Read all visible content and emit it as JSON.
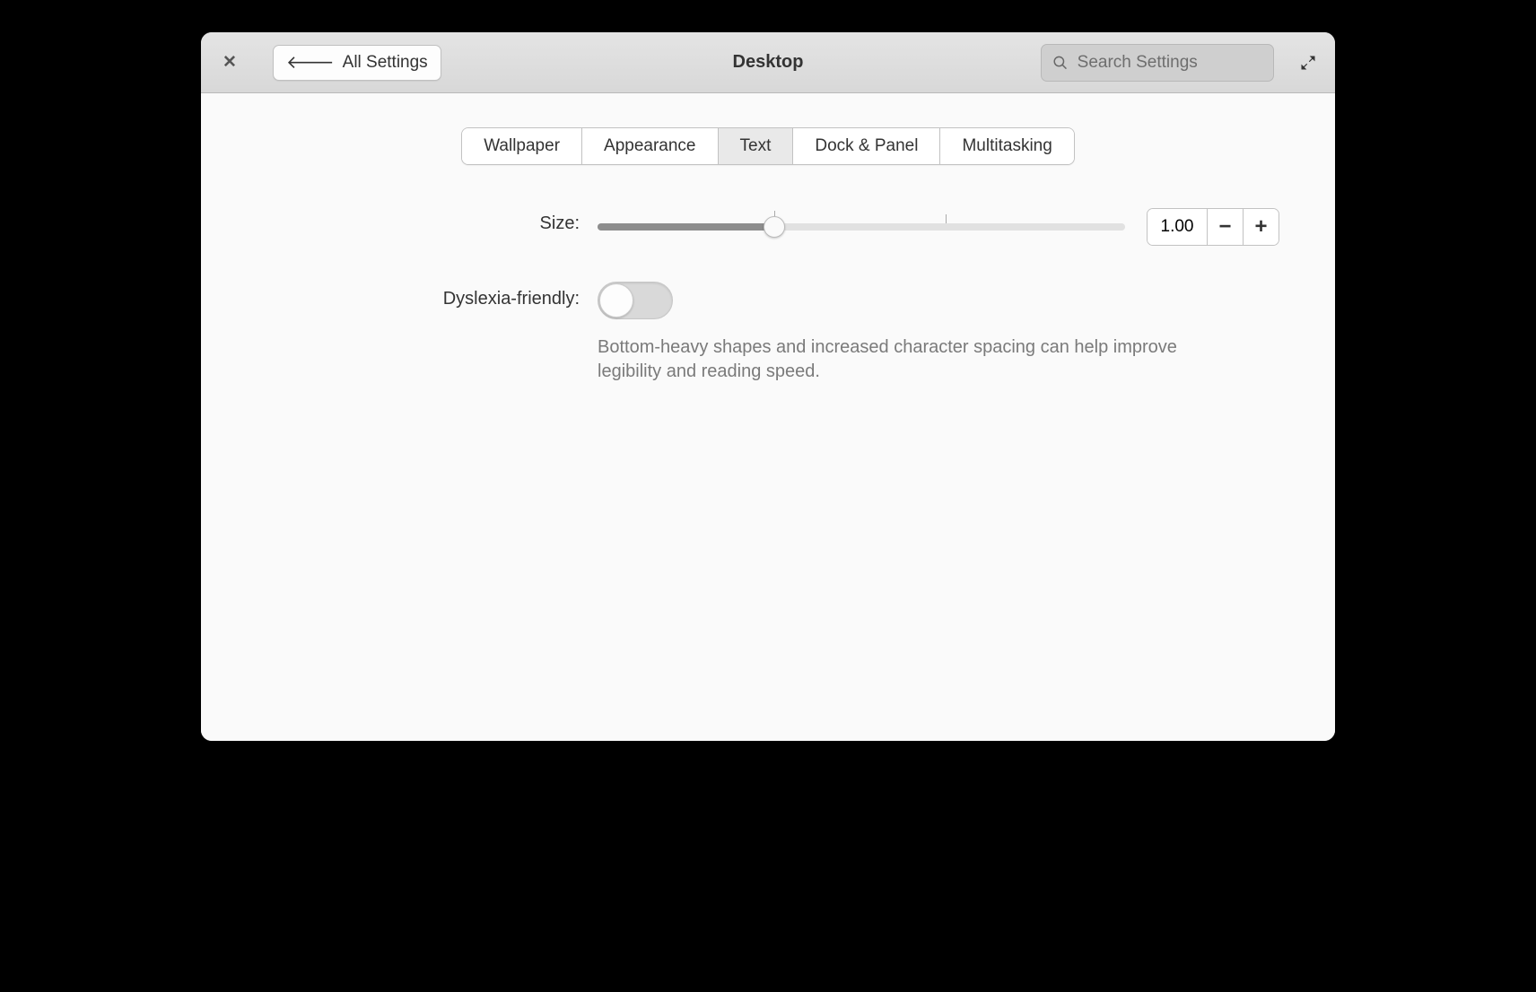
{
  "header": {
    "back_label": "All Settings",
    "title": "Desktop",
    "search_placeholder": "Search Settings"
  },
  "tabs": [
    {
      "label": "Wallpaper",
      "active": false
    },
    {
      "label": "Appearance",
      "active": false
    },
    {
      "label": "Text",
      "active": true
    },
    {
      "label": "Dock & Panel",
      "active": false
    },
    {
      "label": "Multitasking",
      "active": false
    }
  ],
  "size": {
    "label": "Size:",
    "value": "1.00",
    "slider_position_pct": 33.5
  },
  "dyslexia": {
    "label": "Dyslexia-friendly:",
    "enabled": false,
    "description": "Bottom-heavy shapes and increased character spacing can help improve legibility and reading speed."
  }
}
